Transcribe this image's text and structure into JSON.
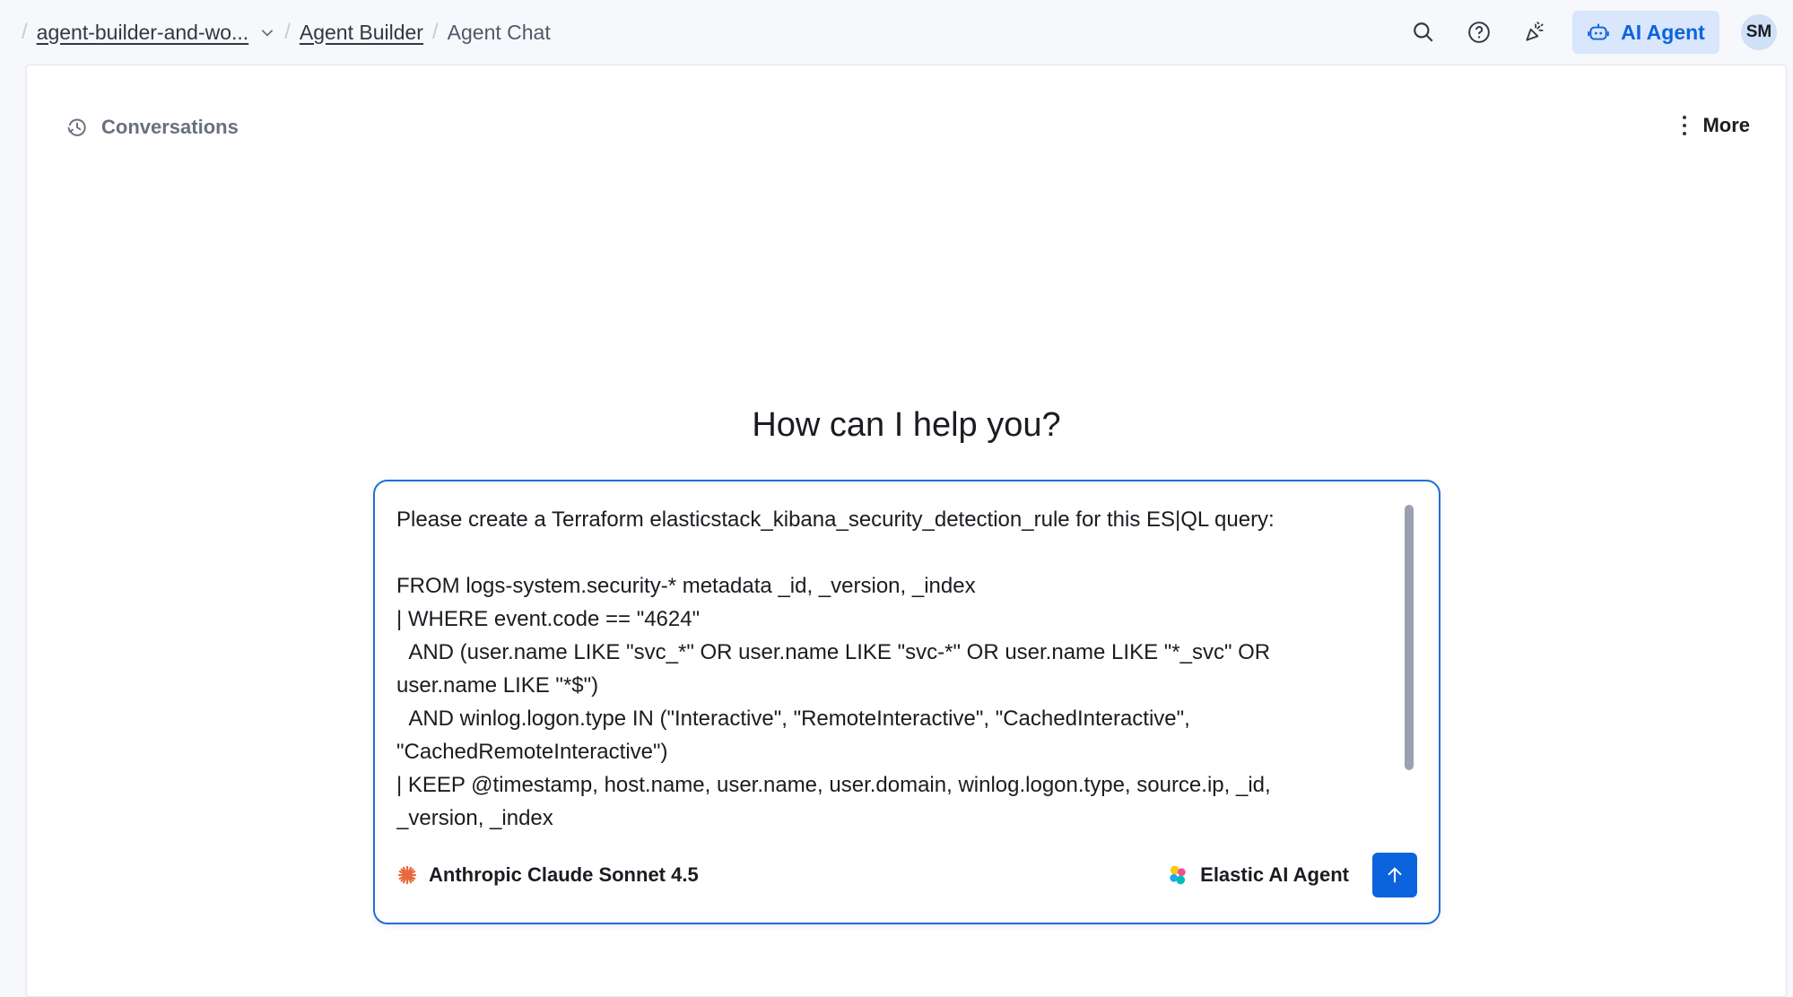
{
  "breadcrumbs": {
    "space": "agent-builder-and-wo...",
    "app": "Agent Builder",
    "current": "Agent Chat"
  },
  "header": {
    "ai_agent_label": "AI Agent",
    "avatar_initials": "SM",
    "icons": [
      "search-icon",
      "help-icon",
      "whats-new-icon",
      "robot-icon"
    ]
  },
  "chat": {
    "conversations_label": "Conversations",
    "more_label": "More",
    "heading": "How can I help you?",
    "prompt": "Please create a Terraform elasticstack_kibana_security_detection_rule for this ES|QL query:\n\nFROM logs-system.security-* metadata _id, _version, _index\n| WHERE event.code == \"4624\"\n  AND (user.name LIKE \"svc_*\" OR user.name LIKE \"svc-*\" OR user.name LIKE \"*_svc\" OR\nuser.name LIKE \"*$\")\n  AND winlog.logon.type IN (\"Interactive\", \"RemoteInteractive\", \"CachedInteractive\",\n\"CachedRemoteInteractive\")\n| KEEP @timestamp, host.name, user.name, user.domain, winlog.logon.type, source.ip, _id,\n_version, _index",
    "model_label": "Anthropic Claude Sonnet 4.5",
    "agent_label": "Elastic AI Agent"
  },
  "colors": {
    "accent": "#0b64dd",
    "accent_light": "#d9e6fb",
    "model_icon": "#e8693b"
  }
}
